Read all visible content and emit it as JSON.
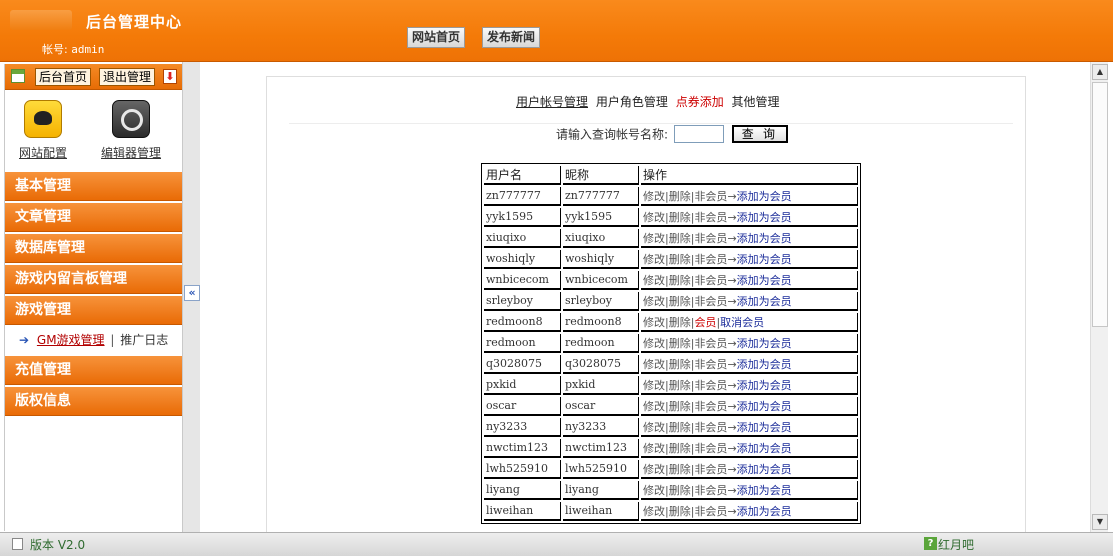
{
  "header": {
    "title": "后台管理中心",
    "account_label": "帐号:",
    "account_value": "admin",
    "nav": [
      "网站首页",
      "发布新闻"
    ]
  },
  "sidebar": {
    "top_buttons": [
      "后台首页",
      "退出管理"
    ],
    "shortcuts": [
      {
        "label": "网站配置",
        "icon": "bird-icon"
      },
      {
        "label": "编辑器管理",
        "icon": "spiral-icon"
      }
    ],
    "menu": [
      "基本管理",
      "文章管理",
      "数据库管理",
      "游戏内留言板管理",
      "游戏管理",
      "充值管理",
      "版权信息"
    ],
    "submenu": {
      "active": "GM游戏管理",
      "separator": "|",
      "other": "推广日志"
    }
  },
  "tabs": [
    "用户帐号管理",
    "用户角色管理",
    "点券添加",
    "其他管理"
  ],
  "search": {
    "label": "请输入查询帐号名称:",
    "value": "",
    "button": "查 询"
  },
  "table": {
    "headers": [
      "用户名",
      "昵称",
      "操作"
    ],
    "op_labels": {
      "edit": "修改",
      "delete": "删除",
      "non_member": "非会员",
      "arrow": "→",
      "add_member": "添加为会员",
      "member": "会员",
      "cancel_member": "取消会员"
    },
    "rows": [
      {
        "username": "zn777777",
        "nickname": "zn777777",
        "member": false
      },
      {
        "username": "yyk1595",
        "nickname": "yyk1595",
        "member": false
      },
      {
        "username": "xiuqixo",
        "nickname": "xiuqixo",
        "member": false
      },
      {
        "username": "woshiqly",
        "nickname": "woshiqly",
        "member": false
      },
      {
        "username": "wnbicecom",
        "nickname": "wnbicecom",
        "member": false
      },
      {
        "username": "srleyboy",
        "nickname": "srleyboy",
        "member": false
      },
      {
        "username": "redmoon8",
        "nickname": "redmoon8",
        "member": true
      },
      {
        "username": "redmoon",
        "nickname": "redmoon",
        "member": false
      },
      {
        "username": "q3028075",
        "nickname": "q3028075",
        "member": false
      },
      {
        "username": "pxkid",
        "nickname": "pxkid",
        "member": false
      },
      {
        "username": "oscar",
        "nickname": "oscar",
        "member": false
      },
      {
        "username": "ny3233",
        "nickname": "ny3233",
        "member": false
      },
      {
        "username": "nwctim123",
        "nickname": "nwctim123",
        "member": false
      },
      {
        "username": "lwh525910",
        "nickname": "lwh525910",
        "member": false
      },
      {
        "username": "liyang",
        "nickname": "liyang",
        "member": false
      },
      {
        "username": "liweihan",
        "nickname": "liweihan",
        "member": false
      }
    ]
  },
  "footer": {
    "version_label": "版本",
    "version": "V2.0",
    "brand": "红月吧"
  },
  "colors": {
    "brand_orange": "#f47a08",
    "link_blue": "#1b2c9a",
    "member_red": "#cc0000"
  }
}
